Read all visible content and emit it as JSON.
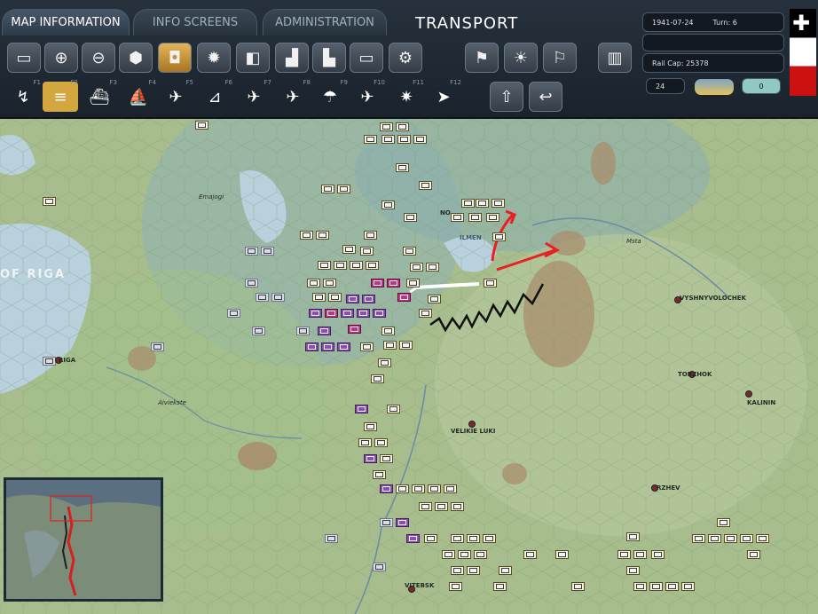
{
  "tabs": [
    {
      "label": "MAP INFORMATION",
      "active": true
    },
    {
      "label": "INFO SCREENS",
      "active": false
    },
    {
      "label": "ADMINISTRATION",
      "active": false
    }
  ],
  "screen_title": "TRANSPORT",
  "status": {
    "date": "1941-07-24",
    "turn": "Turn: 6",
    "rail_cap": "Rail Cap: 25378",
    "counter_left": "24",
    "counter_right": "0"
  },
  "toolbar_row1_icons": [
    "overlay-icon",
    "zoom-in-icon",
    "zoom-out-icon",
    "hex-icon",
    "unit-icon",
    "gear-icon",
    "shapes-icon",
    "graph-icon",
    "factory-icon",
    "rectangle-icon",
    "settings-icon",
    "flag-forward-icon",
    "weather-icon",
    "flag-icon",
    "bars-icon"
  ],
  "toolbar_row2": [
    {
      "icon": "move-icon",
      "key": "F1"
    },
    {
      "icon": "rail-icon",
      "key": "F2"
    },
    {
      "icon": "naval-icon",
      "key": "F3"
    },
    {
      "icon": "ship-icon",
      "key": "F4"
    },
    {
      "icon": "air-recon-icon",
      "key": "F5"
    },
    {
      "icon": "airfield-icon",
      "key": "F6"
    },
    {
      "icon": "air-strike-icon",
      "key": "F7"
    },
    {
      "icon": "bomb-icon",
      "key": "F8"
    },
    {
      "icon": "paradrop-icon",
      "key": "F9"
    },
    {
      "icon": "interdict-icon",
      "key": "F10"
    },
    {
      "icon": "explosion-icon",
      "key": "F11"
    },
    {
      "icon": "next-icon",
      "key": "F12"
    }
  ],
  "map_labels": {
    "riga_gulf": "OF RIGA",
    "riga": "RIGA",
    "ilmen": "ILMEN",
    "novgorod": "NO",
    "vyshnyvolochek": "VYSHNYVOLOCHEK",
    "torzhok": "TORZHOK",
    "kalinin": "KALININ",
    "velikie_luki": "VELIKIE LUKI",
    "rzhev": "RZHEV",
    "vitebsk": "VITEBSK",
    "msta": "Msta",
    "emajogi": "Emajogi",
    "aiviekste": "Aiviekste"
  }
}
